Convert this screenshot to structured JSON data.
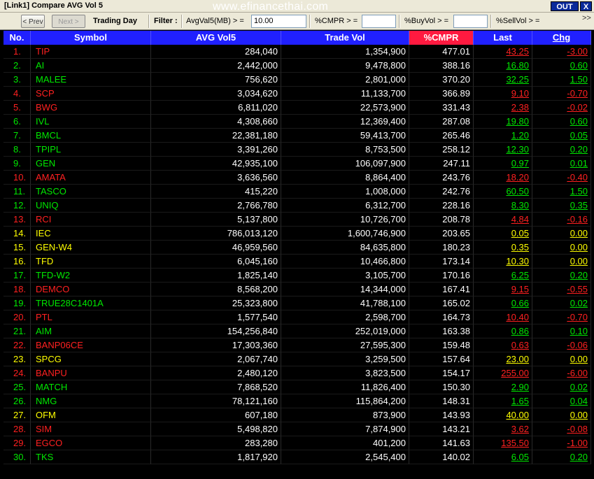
{
  "window": {
    "title": "[Link1] Compare AVG Vol 5",
    "watermark": "www.efinancethai.com",
    "out_label": "OUT",
    "close_label": "X"
  },
  "toolbar": {
    "prev_label": "< Prev",
    "next_label": "Next >",
    "period_label": "Trading Day",
    "filter_label": "Filter :",
    "avgvol_label": "AvgVal5(MB) > =",
    "avgvol_value": "10.00",
    "cmpr_label": "%CMPR > =",
    "cmpr_value": "",
    "buyvol_label": "%BuyVol > =",
    "buyvol_value": "",
    "sellvol_label": "%SellVol > =",
    "more_label": ">>"
  },
  "table": {
    "headers": [
      "No.",
      "Symbol",
      "AVG Vol5",
      "Trade Vol",
      "%CMPR",
      "Last",
      "Chg"
    ],
    "rows": [
      {
        "no": "1.",
        "symbol": "TIP",
        "avg": "284,040",
        "vol": "1,354,900",
        "cmpr": "477.01",
        "last": "43.25",
        "chg": "-3.00",
        "dir": "down"
      },
      {
        "no": "2.",
        "symbol": "AI",
        "avg": "2,442,000",
        "vol": "9,478,800",
        "cmpr": "388.16",
        "last": "16.80",
        "chg": "0.60",
        "dir": "up"
      },
      {
        "no": "3.",
        "symbol": "MALEE",
        "avg": "756,620",
        "vol": "2,801,000",
        "cmpr": "370.20",
        "last": "32.25",
        "chg": "1.50",
        "dir": "up"
      },
      {
        "no": "4.",
        "symbol": "SCP",
        "avg": "3,034,620",
        "vol": "11,133,700",
        "cmpr": "366.89",
        "last": "9.10",
        "chg": "-0.70",
        "dir": "down"
      },
      {
        "no": "5.",
        "symbol": "BWG",
        "avg": "6,811,020",
        "vol": "22,573,900",
        "cmpr": "331.43",
        "last": "2.38",
        "chg": "-0.02",
        "dir": "down"
      },
      {
        "no": "6.",
        "symbol": "IVL",
        "avg": "4,308,660",
        "vol": "12,369,400",
        "cmpr": "287.08",
        "last": "19.80",
        "chg": "0.60",
        "dir": "up"
      },
      {
        "no": "7.",
        "symbol": "BMCL",
        "avg": "22,381,180",
        "vol": "59,413,700",
        "cmpr": "265.46",
        "last": "1.20",
        "chg": "0.05",
        "dir": "up"
      },
      {
        "no": "8.",
        "symbol": "TPIPL",
        "avg": "3,391,260",
        "vol": "8,753,500",
        "cmpr": "258.12",
        "last": "12.30",
        "chg": "0.20",
        "dir": "up"
      },
      {
        "no": "9.",
        "symbol": "GEN",
        "avg": "42,935,100",
        "vol": "106,097,900",
        "cmpr": "247.11",
        "last": "0.97",
        "chg": "0.01",
        "dir": "up"
      },
      {
        "no": "10.",
        "symbol": "AMATA",
        "avg": "3,636,560",
        "vol": "8,864,400",
        "cmpr": "243.76",
        "last": "18.20",
        "chg": "-0.40",
        "dir": "down"
      },
      {
        "no": "11.",
        "symbol": "TASCO",
        "avg": "415,220",
        "vol": "1,008,000",
        "cmpr": "242.76",
        "last": "60.50",
        "chg": "1.50",
        "dir": "up"
      },
      {
        "no": "12.",
        "symbol": "UNIQ",
        "avg": "2,766,780",
        "vol": "6,312,700",
        "cmpr": "228.16",
        "last": "8.30",
        "chg": "0.35",
        "dir": "up"
      },
      {
        "no": "13.",
        "symbol": "RCI",
        "avg": "5,137,800",
        "vol": "10,726,700",
        "cmpr": "208.78",
        "last": "4.84",
        "chg": "-0.16",
        "dir": "down"
      },
      {
        "no": "14.",
        "symbol": "IEC",
        "avg": "786,013,120",
        "vol": "1,600,746,900",
        "cmpr": "203.65",
        "last": "0.05",
        "chg": "0.00",
        "dir": "flat"
      },
      {
        "no": "15.",
        "symbol": "GEN-W4",
        "avg": "46,959,560",
        "vol": "84,635,800",
        "cmpr": "180.23",
        "last": "0.35",
        "chg": "0.00",
        "dir": "flat"
      },
      {
        "no": "16.",
        "symbol": "TFD",
        "avg": "6,045,160",
        "vol": "10,466,800",
        "cmpr": "173.14",
        "last": "10.30",
        "chg": "0.00",
        "dir": "flat"
      },
      {
        "no": "17.",
        "symbol": "TFD-W2",
        "avg": "1,825,140",
        "vol": "3,105,700",
        "cmpr": "170.16",
        "last": "6.25",
        "chg": "0.20",
        "dir": "up"
      },
      {
        "no": "18.",
        "symbol": "DEMCO",
        "avg": "8,568,200",
        "vol": "14,344,000",
        "cmpr": "167.41",
        "last": "9.15",
        "chg": "-0.55",
        "dir": "down"
      },
      {
        "no": "19.",
        "symbol": "TRUE28C1401A",
        "avg": "25,323,800",
        "vol": "41,788,100",
        "cmpr": "165.02",
        "last": "0.66",
        "chg": "0.02",
        "dir": "up"
      },
      {
        "no": "20.",
        "symbol": "PTL",
        "avg": "1,577,540",
        "vol": "2,598,700",
        "cmpr": "164.73",
        "last": "10.40",
        "chg": "-0.70",
        "dir": "down"
      },
      {
        "no": "21.",
        "symbol": "AIM",
        "avg": "154,256,840",
        "vol": "252,019,000",
        "cmpr": "163.38",
        "last": "0.86",
        "chg": "0.10",
        "dir": "up"
      },
      {
        "no": "22.",
        "symbol": "BANP06CE",
        "avg": "17,303,360",
        "vol": "27,595,300",
        "cmpr": "159.48",
        "last": "0.63",
        "chg": "-0.06",
        "dir": "down"
      },
      {
        "no": "23.",
        "symbol": "SPCG",
        "avg": "2,067,740",
        "vol": "3,259,500",
        "cmpr": "157.64",
        "last": "23.00",
        "chg": "0.00",
        "dir": "flat"
      },
      {
        "no": "24.",
        "symbol": "BANPU",
        "avg": "2,480,120",
        "vol": "3,823,500",
        "cmpr": "154.17",
        "last": "255.00",
        "chg": "-6.00",
        "dir": "down"
      },
      {
        "no": "25.",
        "symbol": "MATCH",
        "avg": "7,868,520",
        "vol": "11,826,400",
        "cmpr": "150.30",
        "last": "2.90",
        "chg": "0.02",
        "dir": "up"
      },
      {
        "no": "26.",
        "symbol": "NMG",
        "avg": "78,121,160",
        "vol": "115,864,200",
        "cmpr": "148.31",
        "last": "1.65",
        "chg": "0.04",
        "dir": "up"
      },
      {
        "no": "27.",
        "symbol": "OFM",
        "avg": "607,180",
        "vol": "873,900",
        "cmpr": "143.93",
        "last": "40.00",
        "chg": "0.00",
        "dir": "flat"
      },
      {
        "no": "28.",
        "symbol": "SIM",
        "avg": "5,498,820",
        "vol": "7,874,900",
        "cmpr": "143.21",
        "last": "3.62",
        "chg": "-0.08",
        "dir": "down"
      },
      {
        "no": "29.",
        "symbol": "EGCO",
        "avg": "283,280",
        "vol": "401,200",
        "cmpr": "141.63",
        "last": "135.50",
        "chg": "-1.00",
        "dir": "down"
      },
      {
        "no": "30.",
        "symbol": "TKS",
        "avg": "1,817,920",
        "vol": "2,545,400",
        "cmpr": "140.02",
        "last": "6.05",
        "chg": "0.20",
        "dir": "up"
      }
    ]
  },
  "colors": {
    "up": "#00e800",
    "down": "#ff2020",
    "flat": "#ffff00",
    "header_bg": "#2020ff",
    "cmpr_header_bg": "#ff1a40"
  }
}
